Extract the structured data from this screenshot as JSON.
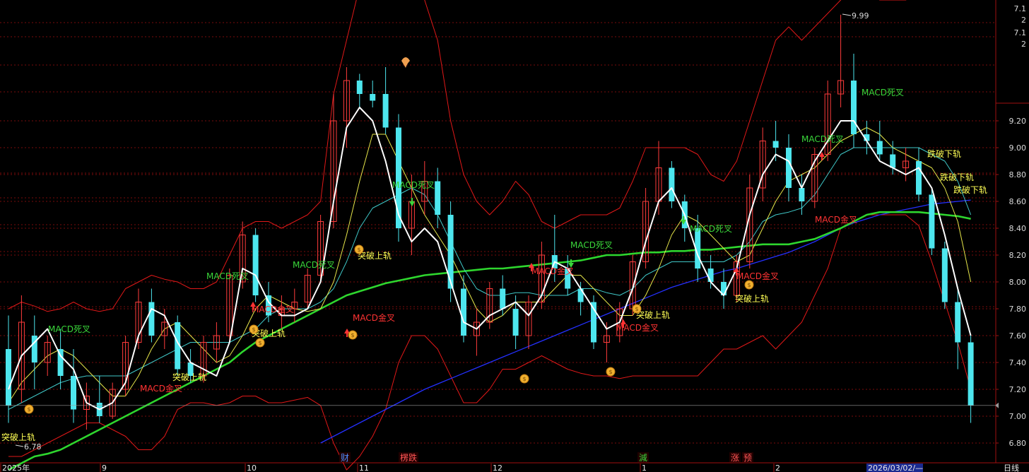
{
  "colors": {
    "background": "#000000",
    "candle_up": "#ff3b3b",
    "candle_down": "#4de6ee",
    "grid": "#7a0c0c",
    "boll": "#e01818",
    "ma5": "#ffffff",
    "ma10": "#e6e64a",
    "ma20": "#3fc7c7",
    "ma60": "#2ed62e",
    "ma120": "#2430ff",
    "golden": "#ff3333",
    "death": "#3ad63a",
    "breakout": "#ffff55",
    "breakdown": "#ffff55"
  },
  "chart_data": {
    "type": "candlestick",
    "ylim": [
      6.75,
      9.3
    ],
    "y_ticks": [
      "9.20",
      "9.00",
      "8.80",
      "8.60",
      "8.40",
      "8.20",
      "8.00",
      "7.80",
      "7.60",
      "7.40",
      "7.20",
      "7.00",
      "6.80"
    ],
    "y_top_labels": [
      "7.1",
      "2",
      "7.1",
      "2"
    ],
    "x_labels": [
      "2025年",
      "9",
      "10",
      "11",
      "12",
      "1",
      "2",
      "2026/03/02/—"
    ],
    "bottom_right_label": "日线",
    "event_markers": [
      {
        "text": "财",
        "color": "#4d8cff"
      },
      {
        "text": "楞跌",
        "color": "#ff5555"
      },
      {
        "text": "減",
        "color": "#3ad63a"
      },
      {
        "text": "涨",
        "color": "#ff5555"
      },
      {
        "text": "预",
        "color": "#ff5555"
      }
    ],
    "high_label": "9.99",
    "low_label": "6.78",
    "last_close": 7.08,
    "annotations": [
      {
        "text": "MACD死叉",
        "kind": "death"
      },
      {
        "text": "MACD死叉",
        "kind": "death"
      },
      {
        "text": "MACD死叉",
        "kind": "death"
      },
      {
        "text": "MACD死叉",
        "kind": "death"
      },
      {
        "text": "MACD死叉",
        "kind": "death"
      },
      {
        "text": "MACD死叉",
        "kind": "death"
      },
      {
        "text": "MACD死叉",
        "kind": "death"
      },
      {
        "text": "MACD死叉",
        "kind": "death"
      },
      {
        "text": "MACD金叉",
        "kind": "golden"
      },
      {
        "text": "MACD金叉",
        "kind": "golden"
      },
      {
        "text": "MACD金叉",
        "kind": "golden"
      },
      {
        "text": "MACD金叉",
        "kind": "golden"
      },
      {
        "text": "MACD金叉",
        "kind": "golden"
      },
      {
        "text": "MACD金叉",
        "kind": "golden"
      },
      {
        "text": "MACD金叉",
        "kind": "golden"
      },
      {
        "text": "突破上轨",
        "kind": "breakout"
      },
      {
        "text": "突破上轨",
        "kind": "breakout"
      },
      {
        "text": "突破上轨",
        "kind": "breakout"
      },
      {
        "text": "突破上轨",
        "kind": "breakout"
      },
      {
        "text": "突破上轨",
        "kind": "breakout"
      },
      {
        "text": "突破上轨",
        "kind": "breakout"
      },
      {
        "text": "跌破下轨",
        "kind": "breakdown"
      },
      {
        "text": "跌破下轨",
        "kind": "breakdown"
      },
      {
        "text": "跌破下轨",
        "kind": "breakdown"
      }
    ],
    "ma5": [
      7.2,
      7.45,
      7.55,
      7.65,
      7.45,
      7.35,
      7.1,
      7.05,
      7.1,
      7.25,
      7.6,
      7.8,
      7.75,
      7.55,
      7.4,
      7.35,
      7.3,
      7.55,
      8.1,
      8.05,
      7.85,
      7.75,
      7.75,
      7.8,
      8.0,
      8.6,
      9.15,
      9.3,
      9.2,
      8.9,
      8.5,
      8.3,
      8.4,
      8.3,
      8.0,
      7.7,
      7.65,
      7.75,
      7.8,
      7.85,
      7.75,
      7.9,
      8.15,
      8.1,
      7.95,
      7.8,
      7.65,
      7.7,
      7.95,
      8.3,
      8.6,
      8.7,
      8.5,
      8.2,
      8.0,
      7.9,
      8.1,
      8.5,
      8.8,
      8.95,
      8.9,
      8.7,
      8.9,
      9.05,
      9.2,
      9.2,
      9.05,
      8.9,
      8.85,
      8.8,
      8.85,
      8.7,
      8.35,
      7.95,
      7.6
    ],
    "ma10": [
      7.1,
      7.25,
      7.35,
      7.45,
      7.5,
      7.45,
      7.35,
      7.25,
      7.15,
      7.15,
      7.3,
      7.5,
      7.65,
      7.7,
      7.6,
      7.5,
      7.4,
      7.45,
      7.6,
      7.8,
      7.9,
      7.85,
      7.8,
      7.78,
      7.8,
      8.0,
      8.35,
      8.75,
      9.1,
      9.1,
      8.9,
      8.7,
      8.5,
      8.35,
      8.2,
      8.0,
      7.8,
      7.7,
      7.75,
      7.85,
      7.85,
      7.85,
      7.95,
      8.05,
      8.05,
      7.95,
      7.85,
      7.75,
      7.75,
      7.9,
      8.1,
      8.35,
      8.5,
      8.45,
      8.35,
      8.25,
      8.15,
      8.2,
      8.4,
      8.6,
      8.75,
      8.8,
      8.85,
      8.95,
      9.05,
      9.1,
      9.15,
      9.1,
      9.0,
      8.95,
      8.9,
      8.85,
      8.7,
      8.45,
      8.0
    ],
    "ma20": [
      7.05,
      7.1,
      7.15,
      7.2,
      7.25,
      7.28,
      7.3,
      7.3,
      7.3,
      7.3,
      7.35,
      7.4,
      7.45,
      7.5,
      7.55,
      7.55,
      7.55,
      7.55,
      7.6,
      7.65,
      7.75,
      7.8,
      7.8,
      7.8,
      7.85,
      7.95,
      8.15,
      8.4,
      8.55,
      8.6,
      8.65,
      8.7,
      8.65,
      8.5,
      8.3,
      8.1,
      7.95,
      7.9,
      7.9,
      7.92,
      7.92,
      7.9,
      7.9,
      7.9,
      7.95,
      7.95,
      7.92,
      7.9,
      7.95,
      8.05,
      8.1,
      8.15,
      8.15,
      8.15,
      8.15,
      8.15,
      8.2,
      8.3,
      8.45,
      8.5,
      8.52,
      8.55,
      8.65,
      8.8,
      8.95,
      9.0,
      9.0,
      9.0,
      9.0,
      9.0,
      9.0,
      8.95,
      8.9,
      8.75,
      8.5
    ],
    "ma60": [
      6.6,
      6.65,
      6.7,
      6.72,
      6.75,
      6.8,
      6.85,
      6.9,
      6.95,
      7.0,
      7.05,
      7.1,
      7.15,
      7.2,
      7.25,
      7.3,
      7.35,
      7.4,
      7.48,
      7.55,
      7.6,
      7.65,
      7.7,
      7.75,
      7.8,
      7.85,
      7.9,
      7.93,
      7.96,
      7.99,
      8.01,
      8.03,
      8.05,
      8.06,
      8.07,
      8.08,
      8.09,
      8.1,
      8.1,
      8.11,
      8.12,
      8.13,
      8.14,
      8.15,
      8.16,
      8.18,
      8.2,
      8.2,
      8.21,
      8.22,
      8.22,
      8.23,
      8.23,
      8.24,
      8.24,
      8.25,
      8.26,
      8.27,
      8.28,
      8.28,
      8.28,
      8.3,
      8.32,
      8.36,
      8.4,
      8.45,
      8.5,
      8.52,
      8.52,
      8.52,
      8.52,
      8.51,
      8.5,
      8.49,
      8.47
    ],
    "ma120": [
      null,
      null,
      null,
      null,
      null,
      null,
      null,
      null,
      null,
      null,
      null,
      null,
      null,
      null,
      null,
      null,
      null,
      null,
      null,
      null,
      null,
      null,
      null,
      null,
      6.8,
      6.85,
      6.9,
      6.95,
      7.0,
      7.05,
      7.1,
      7.15,
      7.2,
      7.24,
      7.28,
      7.32,
      7.36,
      7.4,
      7.44,
      7.48,
      7.52,
      7.56,
      7.6,
      7.64,
      7.68,
      7.72,
      7.76,
      7.8,
      7.84,
      7.88,
      7.92,
      7.96,
      7.99,
      8.02,
      8.05,
      8.08,
      8.1,
      8.13,
      8.16,
      8.19,
      8.22,
      8.26,
      8.3,
      8.35,
      8.4,
      8.44,
      8.47,
      8.5,
      8.52,
      8.54,
      8.56,
      8.58,
      8.59,
      8.6,
      8.61
    ],
    "boll_upper": [
      7.8,
      7.85,
      7.82,
      7.78,
      7.8,
      7.85,
      7.8,
      7.78,
      7.8,
      7.95,
      8.0,
      8.05,
      8.02,
      8.0,
      7.95,
      7.95,
      8.0,
      8.2,
      8.4,
      8.45,
      8.45,
      8.4,
      8.45,
      8.5,
      8.6,
      9.4,
      9.8,
      10.2,
      10.2,
      10.2,
      10.2,
      10.2,
      10.1,
      9.8,
      9.2,
      8.8,
      8.6,
      8.5,
      8.6,
      8.75,
      8.65,
      8.45,
      8.4,
      8.45,
      8.5,
      8.5,
      8.5,
      8.55,
      8.75,
      9.0,
      9.0,
      9.0,
      9.0,
      8.95,
      8.8,
      8.75,
      8.9,
      9.2,
      9.5,
      9.8,
      9.9,
      9.8,
      9.9,
      10.0,
      10.1,
      10.2,
      10.15,
      10.1,
      10.1,
      10.1,
      10.15,
      10.25,
      10.3,
      10.35,
      10.25
    ],
    "boll_lower": [
      6.7,
      6.7,
      6.75,
      6.8,
      6.85,
      6.9,
      6.95,
      6.95,
      6.9,
      6.85,
      6.75,
      6.75,
      6.85,
      7.05,
      7.1,
      7.1,
      7.08,
      7.1,
      7.15,
      7.15,
      7.1,
      7.1,
      7.12,
      7.14,
      7.08,
      6.8,
      6.6,
      6.7,
      6.85,
      7.05,
      7.4,
      7.6,
      7.6,
      7.5,
      7.3,
      7.1,
      7.1,
      7.2,
      7.35,
      7.35,
      7.4,
      7.45,
      7.4,
      7.35,
      7.32,
      7.3,
      7.3,
      7.28,
      7.3,
      7.3,
      7.3,
      7.3,
      7.3,
      7.3,
      7.4,
      7.5,
      7.5,
      7.55,
      7.6,
      7.5,
      7.6,
      7.7,
      7.9,
      8.1,
      8.4,
      8.45,
      8.5,
      8.5,
      8.5,
      8.5,
      8.42,
      8.15,
      7.85,
      7.55,
      7.2
    ],
    "candles": [
      {
        "o": 7.5,
        "h": 7.75,
        "l": 6.95,
        "c": 7.08
      },
      {
        "o": 7.2,
        "h": 7.9,
        "l": 7.1,
        "c": 7.7
      },
      {
        "o": 7.6,
        "h": 7.75,
        "l": 7.2,
        "c": 7.4
      },
      {
        "o": 7.4,
        "h": 7.6,
        "l": 7.3,
        "c": 7.55
      },
      {
        "o": 7.5,
        "h": 7.65,
        "l": 7.2,
        "c": 7.3
      },
      {
        "o": 7.3,
        "h": 7.5,
        "l": 6.95,
        "c": 7.05
      },
      {
        "o": 7.05,
        "h": 7.25,
        "l": 6.9,
        "c": 7.15
      },
      {
        "o": 7.1,
        "h": 7.3,
        "l": 6.95,
        "c": 7.0
      },
      {
        "o": 7.0,
        "h": 7.25,
        "l": 6.98,
        "c": 7.2
      },
      {
        "o": 7.2,
        "h": 7.6,
        "l": 7.15,
        "c": 7.55
      },
      {
        "o": 7.55,
        "h": 7.95,
        "l": 7.5,
        "c": 7.85
      },
      {
        "o": 7.85,
        "h": 7.95,
        "l": 7.55,
        "c": 7.6
      },
      {
        "o": 7.6,
        "h": 7.8,
        "l": 7.5,
        "c": 7.7
      },
      {
        "o": 7.7,
        "h": 7.75,
        "l": 7.3,
        "c": 7.35
      },
      {
        "o": 7.4,
        "h": 7.5,
        "l": 7.25,
        "c": 7.3
      },
      {
        "o": 7.3,
        "h": 7.6,
        "l": 7.25,
        "c": 7.55
      },
      {
        "o": 7.5,
        "h": 7.7,
        "l": 7.4,
        "c": 7.6
      },
      {
        "o": 7.6,
        "h": 8.1,
        "l": 7.55,
        "c": 8.05
      },
      {
        "o": 8.0,
        "h": 8.45,
        "l": 7.95,
        "c": 8.35
      },
      {
        "o": 8.35,
        "h": 8.4,
        "l": 7.85,
        "c": 7.9
      },
      {
        "o": 7.9,
        "h": 8.0,
        "l": 7.7,
        "c": 7.75
      },
      {
        "o": 7.75,
        "h": 7.9,
        "l": 7.65,
        "c": 7.8
      },
      {
        "o": 7.8,
        "h": 7.95,
        "l": 7.7,
        "c": 7.85
      },
      {
        "o": 7.85,
        "h": 8.1,
        "l": 7.8,
        "c": 8.05
      },
      {
        "o": 8.05,
        "h": 8.5,
        "l": 8.0,
        "c": 8.45
      },
      {
        "o": 8.45,
        "h": 9.4,
        "l": 8.4,
        "c": 9.2
      },
      {
        "o": 9.2,
        "h": 9.6,
        "l": 9.0,
        "c": 9.5
      },
      {
        "o": 9.5,
        "h": 9.55,
        "l": 9.3,
        "c": 9.4
      },
      {
        "o": 9.4,
        "h": 9.5,
        "l": 9.3,
        "c": 9.35
      },
      {
        "o": 9.4,
        "h": 9.6,
        "l": 9.1,
        "c": 9.15
      },
      {
        "o": 9.15,
        "h": 9.25,
        "l": 8.3,
        "c": 8.4
      },
      {
        "o": 8.4,
        "h": 8.8,
        "l": 8.2,
        "c": 8.6
      },
      {
        "o": 8.6,
        "h": 8.9,
        "l": 8.5,
        "c": 8.75
      },
      {
        "o": 8.75,
        "h": 8.85,
        "l": 8.4,
        "c": 8.5
      },
      {
        "o": 8.5,
        "h": 8.6,
        "l": 7.85,
        "c": 7.95
      },
      {
        "o": 7.95,
        "h": 8.05,
        "l": 7.55,
        "c": 7.6
      },
      {
        "o": 7.6,
        "h": 7.8,
        "l": 7.45,
        "c": 7.7
      },
      {
        "o": 7.7,
        "h": 8.0,
        "l": 7.65,
        "c": 7.95
      },
      {
        "o": 7.95,
        "h": 8.05,
        "l": 7.75,
        "c": 7.8
      },
      {
        "o": 7.8,
        "h": 7.9,
        "l": 7.5,
        "c": 7.6
      },
      {
        "o": 7.6,
        "h": 7.9,
        "l": 7.5,
        "c": 7.85
      },
      {
        "o": 7.85,
        "h": 8.3,
        "l": 7.8,
        "c": 8.2
      },
      {
        "o": 8.2,
        "h": 8.5,
        "l": 8.0,
        "c": 8.1
      },
      {
        "o": 8.1,
        "h": 8.2,
        "l": 7.9,
        "c": 7.95
      },
      {
        "o": 7.95,
        "h": 8.0,
        "l": 7.75,
        "c": 7.85
      },
      {
        "o": 7.85,
        "h": 7.9,
        "l": 7.5,
        "c": 7.55
      },
      {
        "o": 7.55,
        "h": 7.7,
        "l": 7.4,
        "c": 7.6
      },
      {
        "o": 7.6,
        "h": 7.85,
        "l": 7.55,
        "c": 7.8
      },
      {
        "o": 7.8,
        "h": 8.2,
        "l": 7.75,
        "c": 8.15
      },
      {
        "o": 8.15,
        "h": 8.7,
        "l": 8.1,
        "c": 8.6
      },
      {
        "o": 8.6,
        "h": 9.05,
        "l": 8.5,
        "c": 8.85
      },
      {
        "o": 8.85,
        "h": 8.9,
        "l": 8.55,
        "c": 8.6
      },
      {
        "o": 8.6,
        "h": 8.65,
        "l": 8.3,
        "c": 8.4
      },
      {
        "o": 8.4,
        "h": 8.5,
        "l": 8.0,
        "c": 8.1
      },
      {
        "o": 8.1,
        "h": 8.2,
        "l": 7.95,
        "c": 8.0
      },
      {
        "o": 8.0,
        "h": 8.1,
        "l": 7.8,
        "c": 7.9
      },
      {
        "o": 7.9,
        "h": 8.2,
        "l": 7.85,
        "c": 8.15
      },
      {
        "o": 8.15,
        "h": 8.8,
        "l": 8.1,
        "c": 8.7
      },
      {
        "o": 8.7,
        "h": 9.15,
        "l": 8.6,
        "c": 9.05
      },
      {
        "o": 9.05,
        "h": 9.2,
        "l": 8.9,
        "c": 9.0
      },
      {
        "o": 9.0,
        "h": 9.1,
        "l": 8.6,
        "c": 8.7
      },
      {
        "o": 8.7,
        "h": 8.8,
        "l": 8.5,
        "c": 8.6
      },
      {
        "o": 8.6,
        "h": 9.0,
        "l": 8.55,
        "c": 8.95
      },
      {
        "o": 8.95,
        "h": 9.5,
        "l": 8.9,
        "c": 9.4
      },
      {
        "o": 9.4,
        "h": 9.99,
        "l": 9.3,
        "c": 9.5
      },
      {
        "o": 9.5,
        "h": 9.7,
        "l": 9.0,
        "c": 9.1
      },
      {
        "o": 9.1,
        "h": 9.2,
        "l": 8.95,
        "c": 9.05
      },
      {
        "o": 9.05,
        "h": 9.2,
        "l": 8.9,
        "c": 8.95
      },
      {
        "o": 8.95,
        "h": 9.05,
        "l": 8.8,
        "c": 8.85
      },
      {
        "o": 8.85,
        "h": 9.0,
        "l": 8.75,
        "c": 8.9
      },
      {
        "o": 8.9,
        "h": 9.0,
        "l": 8.6,
        "c": 8.65
      },
      {
        "o": 8.65,
        "h": 8.7,
        "l": 8.2,
        "c": 8.25
      },
      {
        "o": 8.25,
        "h": 8.3,
        "l": 7.8,
        "c": 7.85
      },
      {
        "o": 7.85,
        "h": 7.95,
        "l": 7.35,
        "c": 7.55
      },
      {
        "o": 7.55,
        "h": 7.6,
        "l": 6.95,
        "c": 7.08
      }
    ]
  }
}
